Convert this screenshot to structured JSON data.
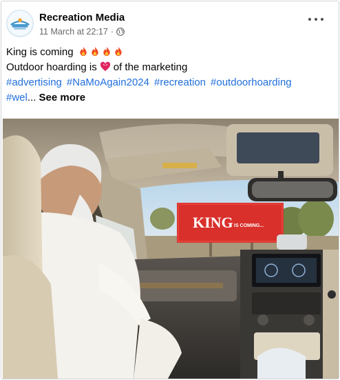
{
  "post": {
    "page_name": "Recreation Media",
    "timestamp": "11 March at 22:17",
    "separator": "·",
    "privacy_icon": "globe-icon",
    "more_icon": "more-options-icon",
    "lines": {
      "line1_text": "King is coming",
      "line1_emoji": "fire",
      "line2_prefix": "Outdoor hoarding is",
      "line2_emoji": "heart",
      "line2_suffix": "of the marketing"
    },
    "hashtags": [
      "#advertising",
      "#NaMoAgain2024",
      "#recreation",
      "#outdoorhoarding"
    ],
    "hashtag_truncated": "#wel",
    "ellipsis": "...",
    "see_more": "See more"
  },
  "photo": {
    "billboard_title": "KING",
    "billboard_subtitle": "IS COMING..."
  },
  "colors": {
    "link": "#216fdb",
    "secondary_text": "#65676b",
    "billboard_red": "#d9302c"
  }
}
